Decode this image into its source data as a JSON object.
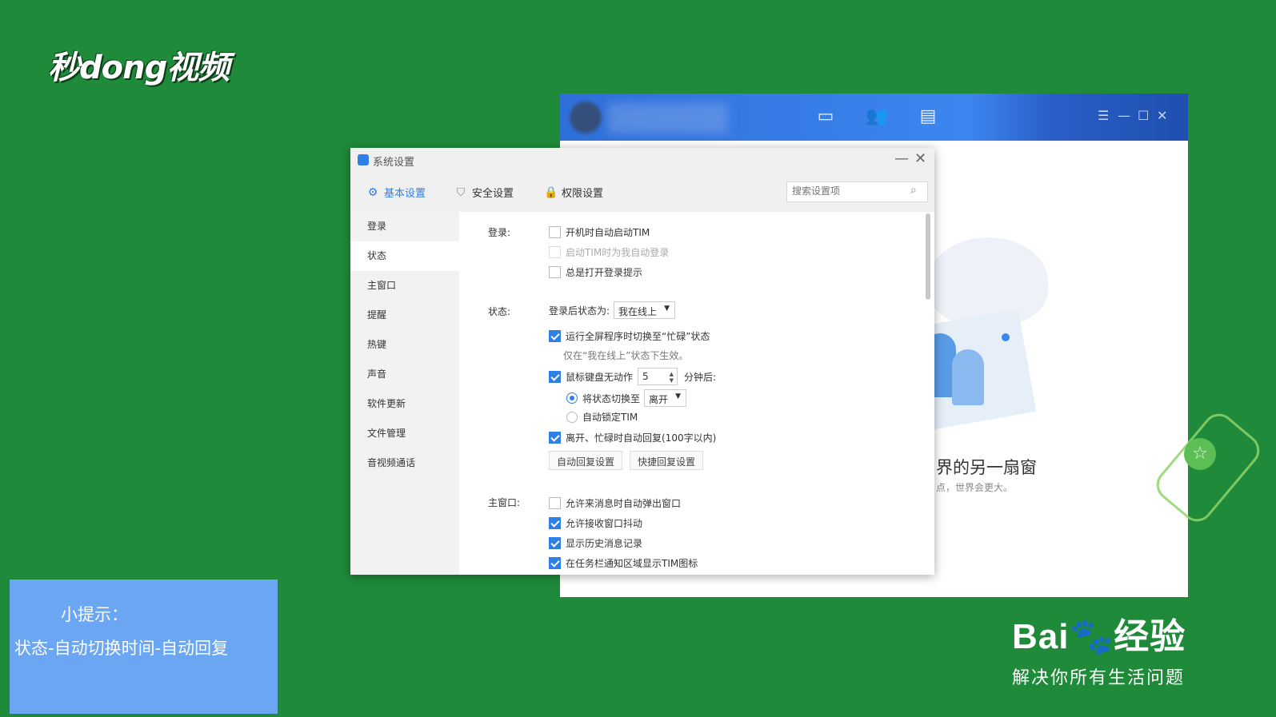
{
  "watermark": {
    "logo_text": "秒dong视频",
    "brand": "Bai",
    "brand_suffix": "经验",
    "tagline": "解决你所有生活问题"
  },
  "tim_window": {
    "slogan": "界的另一扇窗",
    "sub": "点，世界会更大。",
    "icons": [
      "message-icon",
      "contacts-icon",
      "files-icon"
    ],
    "controls": [
      "menu-icon",
      "minimize-icon",
      "maximize-icon",
      "close-icon"
    ]
  },
  "dialog": {
    "title": "系统设置",
    "tabs": [
      {
        "label": "基本设置",
        "icon": "gear-icon",
        "active": true
      },
      {
        "label": "安全设置",
        "icon": "shield-icon",
        "active": false
      },
      {
        "label": "权限设置",
        "icon": "lock-icon",
        "active": false
      }
    ],
    "search_placeholder": "搜索设置项",
    "sidebar": [
      "登录",
      "状态",
      "主窗口",
      "提醒",
      "热键",
      "声音",
      "软件更新",
      "文件管理",
      "音视频通话"
    ],
    "selected_sidebar": "状态",
    "login": {
      "label": "登录:",
      "options": [
        {
          "text": "开机时自动启动TIM",
          "checked": false,
          "disabled": false
        },
        {
          "text": "启动TIM时为我自动登录",
          "checked": false,
          "disabled": true
        },
        {
          "text": "总是打开登录提示",
          "checked": false,
          "disabled": false
        }
      ]
    },
    "status": {
      "label": "状态:",
      "after_login_label": "登录后状态为:",
      "after_login_value": "我在线上",
      "fullscreen_busy": {
        "text": "运行全屏程序时切换至“忙碌”状态",
        "checked": true
      },
      "fullscreen_note": "仅在“我在线上”状态下生效。",
      "idle": {
        "text": "鼠标键盘无动作",
        "checked": true,
        "value": "5",
        "suffix": "分钟后:"
      },
      "switch_to": {
        "text": "将状态切换至",
        "selected": true,
        "value": "离开"
      },
      "auto_lock": {
        "text": "自动锁定TIM",
        "selected": false
      },
      "auto_reply": {
        "text": "离开、忙碌时自动回复(100字以内)",
        "checked": true
      },
      "buttons": [
        "自动回复设置",
        "快捷回复设置"
      ]
    },
    "main_window": {
      "label": "主窗口:",
      "options": [
        {
          "text": "允许来消息时自动弹出窗口",
          "checked": false
        },
        {
          "text": "允许接收窗口抖动",
          "checked": true
        },
        {
          "text": "显示历史消息记录",
          "checked": true
        },
        {
          "text": "在任务栏通知区域显示TIM图标",
          "checked": true
        }
      ]
    }
  },
  "tip": {
    "title": "小提示：",
    "text": "状态-自动切换时间-自动回复"
  }
}
